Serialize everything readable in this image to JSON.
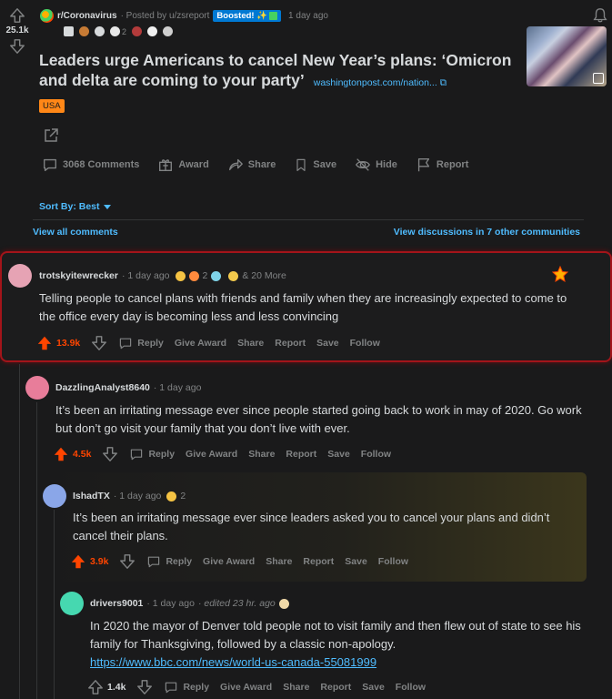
{
  "post": {
    "score": "25.1k",
    "subreddit": "r/Coronavirus",
    "posted_by": "· Posted by u/zsreport",
    "boosted": "Boosted! ✨",
    "time": "1 day ago",
    "award_count": "2",
    "title": "Leaders urge Americans to cancel New Year’s plans: ‘Omicron and delta are coming to your party’",
    "link": "washingtonpost.com/nation...",
    "flair": "USA",
    "actions": {
      "comments": "3068 Comments",
      "award": "Award",
      "share": "Share",
      "save": "Save",
      "hide": "Hide",
      "report": "Report"
    }
  },
  "sort_label": "Sort By: Best",
  "view_all": "View all comments",
  "view_discussions": "View discussions in 7 other communities",
  "comment_actions": {
    "reply": "Reply",
    "give_award": "Give Award",
    "share": "Share",
    "report": "Report",
    "save": "Save",
    "follow": "Follow"
  },
  "comments": [
    {
      "user": "trotskyitewrecker",
      "time": "· 1 day ago",
      "award_count": "2",
      "more": "& 20 More",
      "body": "Telling people to cancel plans with friends and family when they are increasingly expected to come to the office every day is becoming less and less convincing",
      "score": "13.9k",
      "avatar_color": "#e6a3b4"
    },
    {
      "user": "DazzlingAnalyst8640",
      "time": "· 1 day ago",
      "body": "It’s been an irritating message ever since people started going back to work in may of 2020. Go work but don’t go visit your family that you don’t live with ever.",
      "score": "4.5k",
      "avatar_color": "#e87d9a"
    },
    {
      "user": "IshadTX",
      "time": "· 1 day ago",
      "award_count": "2",
      "body": "It’s been an irritating message ever since leaders asked you to cancel your plans and didn’t cancel their plans.",
      "score": "3.9k",
      "avatar_color": "#8aa6e8"
    },
    {
      "user": "drivers9001",
      "time": "· 1 day ago",
      "edited": "· edited 23 hr. ago",
      "body": "In 2020 the mayor of Denver told people not to visit family and then flew out of state to see his family for Thanksgiving, followed by a classic non-apology.",
      "link": "https://www.bbc.com/news/world-us-canada-55081999",
      "score": "1.4k",
      "avatar_color": "#46d8b0"
    }
  ]
}
